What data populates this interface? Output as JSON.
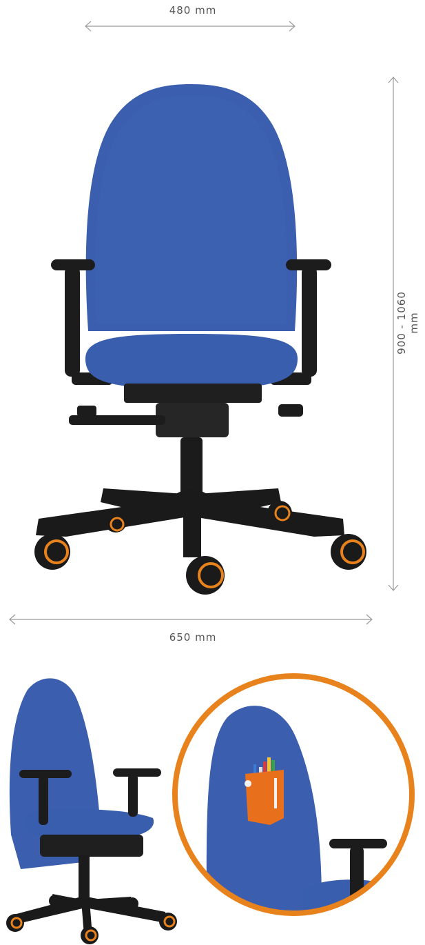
{
  "dimensions": {
    "width_label": "480 mm",
    "height_label": "900 - 1060 mm",
    "depth_label": "650 mm"
  },
  "colors": {
    "fabric": "#3b5fae",
    "fabric_dark": "#2f4f96",
    "frame": "#1c1c1c",
    "wheel_accent": "#e8821c",
    "pocket": "#e8701c",
    "dimension_line": "#9a9a9a"
  },
  "images": {
    "front_view": "office-chair-front-view",
    "side_view": "office-chair-three-quarter-view",
    "detail": "backrest-pocket-with-pens-detail"
  }
}
